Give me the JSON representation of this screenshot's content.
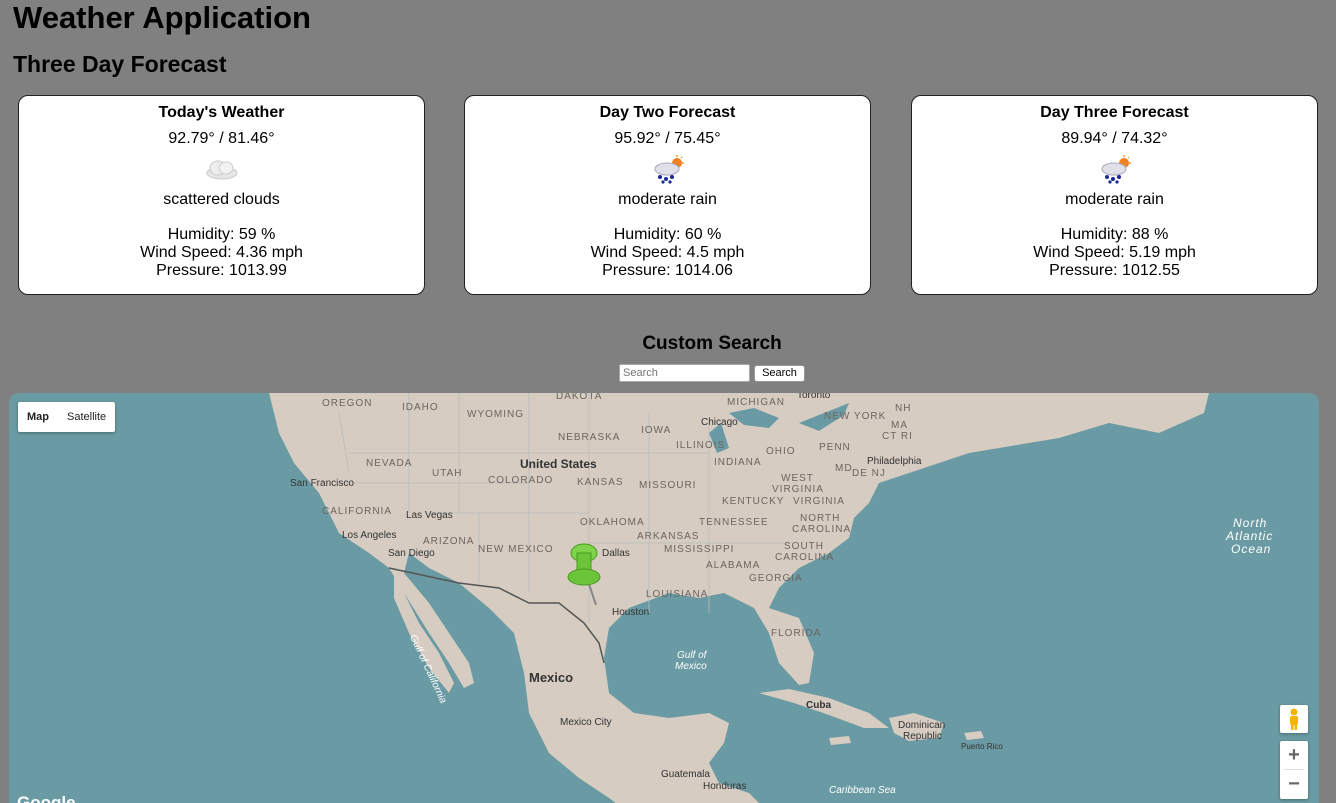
{
  "app_title": "Weather Application",
  "forecast_heading": "Three Day Forecast",
  "cards": [
    {
      "title": "Today's Weather",
      "temps": "92.79° / 81.46°",
      "icon": "scattered-clouds-icon",
      "description": "scattered clouds",
      "humidity": "Humidity: 59 %",
      "wind": "Wind Speed: 4.36 mph",
      "pressure": "Pressure: 1013.99"
    },
    {
      "title": "Day Two Forecast",
      "temps": "95.92° / 75.45°",
      "icon": "rain-icon",
      "description": "moderate rain",
      "humidity": "Humidity: 60 %",
      "wind": "Wind Speed: 4.5 mph",
      "pressure": "Pressure: 1014.06"
    },
    {
      "title": "Day Three Forecast",
      "temps": "89.94° / 74.32°",
      "icon": "rain-icon",
      "description": "moderate rain",
      "humidity": "Humidity: 88 %",
      "wind": "Wind Speed: 5.19 mph",
      "pressure": "Pressure: 1012.55"
    }
  ],
  "search": {
    "heading": "Custom Search",
    "placeholder": "Search",
    "value": "",
    "button_label": "Search"
  },
  "map": {
    "type_buttons": {
      "map": "Map",
      "satellite": "Satellite"
    },
    "zoom_in": "+",
    "zoom_out": "−",
    "logo": "Google",
    "marker_icon": "green-pushpin-icon",
    "labels": {
      "oregon": "OREGON",
      "idaho": "IDAHO",
      "wyoming": "WYOMING",
      "dakota": "DAKOTA",
      "michigan": "MICHIGAN",
      "toronto": "Toronto",
      "new_york": "NEW YORK",
      "nh": "NH",
      "ma": "MA",
      "ct": "CT RI",
      "nebraska": "NEBRASKA",
      "iowa": "IOWA",
      "chicago": "Chicago",
      "illinois": "ILLINOIS",
      "ohio": "OHIO",
      "penn": "PENN",
      "nevada": "NEVADA",
      "utah": "UTAH",
      "united_states": "United States",
      "colorado": "COLORADO",
      "kansas": "KANSAS",
      "missouri": "MISSOURI",
      "indiana": "INDIANA",
      "md": "MD",
      "dej": "DE NJ",
      "philadelphia": "Philadelphia",
      "san_francisco": "San Francisco",
      "west_virginia_1": "WEST",
      "west_virginia_2": "VIRGINIA",
      "kentucky": "KENTUCKY",
      "virginia": "VIRGINIA",
      "california": "CALIFORNIA",
      "las_vegas": "Las Vegas",
      "oklahoma": "OKLAHOMA",
      "tennessee": "TENNESSEE",
      "north_carolina_1": "NORTH",
      "north_carolina_2": "CAROLINA",
      "los_angeles": "Los Angeles",
      "arizona": "ARIZONA",
      "arkansas": "ARKANSAS",
      "san_diego": "San Diego",
      "new_mexico": "NEW MEXICO",
      "dallas": "Dallas",
      "mississippi": "MISSISSIPPI",
      "south_carolina_1": "SOUTH",
      "south_carolina_2": "CAROLINA",
      "alabama": "ALABAMA",
      "georgia": "GEORGIA",
      "louisiana": "LOUISIANA",
      "houston": "Houston",
      "florida": "FLORIDA",
      "gulf_california": "Gulf of California",
      "gulf_mexico_1": "Gulf of",
      "gulf_mexico_2": "Mexico",
      "mexico": "Mexico",
      "cuba": "Cuba",
      "dominican_1": "Dominican",
      "dominican_2": "Republic",
      "puerto_rico": "Puerto Rico",
      "mexico_city": "Mexico City",
      "guatemala": "Guatemala",
      "honduras": "Honduras",
      "caribbean": "Caribbean Sea",
      "north_atlantic_1": "North",
      "north_atlantic_2": "Atlantic",
      "north_atlantic_3": "Ocean"
    }
  },
  "colors": {
    "background": "#808080",
    "card": "#ffffff",
    "water": "#6a9aa3",
    "land": "#d9cfc5"
  }
}
